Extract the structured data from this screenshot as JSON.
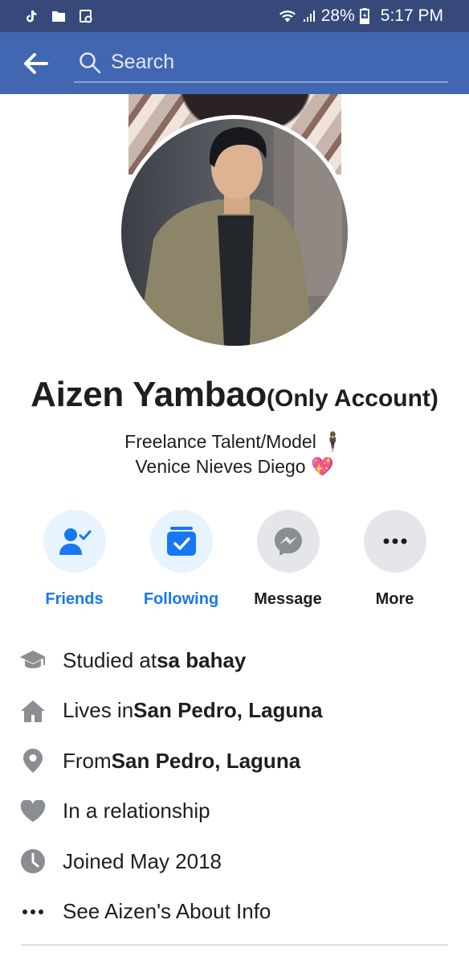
{
  "status_bar": {
    "battery": "28%",
    "time": "5:17 PM",
    "icons": [
      "tiktok-icon",
      "folder-icon",
      "gallery-icon",
      "wifi-icon",
      "signal-icon",
      "battery-icon"
    ]
  },
  "header": {
    "search_placeholder": "Search",
    "colors": {
      "bar": "#4267b2",
      "status": "#36497a"
    }
  },
  "profile": {
    "name": "Aizen Yambao",
    "name_suffix": "(Only Account)",
    "bio_line1": "Freelance Talent/Model 🕴",
    "bio_line2": "Venice Nieves Diego 💖"
  },
  "actions": [
    {
      "label": "Friends",
      "icon": "friends-check-icon",
      "active": true
    },
    {
      "label": "Following",
      "icon": "following-check-icon",
      "active": true
    },
    {
      "label": "Message",
      "icon": "messenger-icon",
      "active": false
    },
    {
      "label": "More",
      "icon": "more-dots-icon",
      "active": false
    }
  ],
  "info": {
    "studied_prefix": "Studied at ",
    "studied_place": "sa bahay",
    "lives_prefix": "Lives in ",
    "lives_place": "San Pedro, Laguna",
    "from_prefix": "From ",
    "from_place": "San Pedro, Laguna",
    "relationship": "In a relationship",
    "joined": "Joined May 2018",
    "see_about": "See Aizen's About Info"
  },
  "accent_colors": {
    "blue": "#1877f2",
    "light_blue": "#e7f3ff",
    "grey": "#e4e6eb",
    "icon_grey": "#8a8d91"
  }
}
